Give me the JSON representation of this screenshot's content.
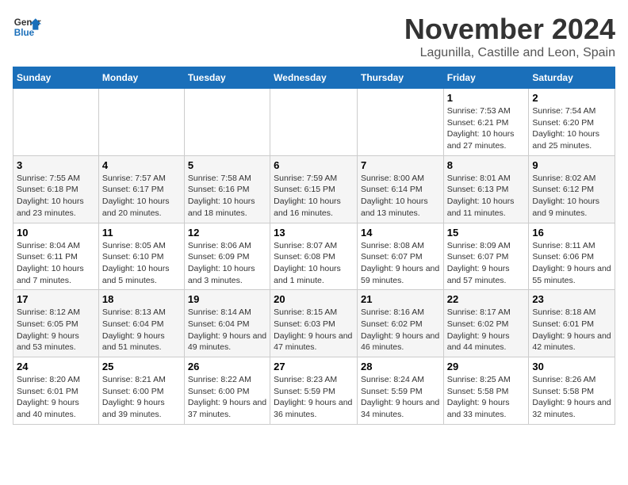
{
  "logo": {
    "line1": "General",
    "line2": "Blue"
  },
  "title": "November 2024",
  "location": "Lagunilla, Castille and Leon, Spain",
  "headers": [
    "Sunday",
    "Monday",
    "Tuesday",
    "Wednesday",
    "Thursday",
    "Friday",
    "Saturday"
  ],
  "weeks": [
    [
      {
        "day": "",
        "info": ""
      },
      {
        "day": "",
        "info": ""
      },
      {
        "day": "",
        "info": ""
      },
      {
        "day": "",
        "info": ""
      },
      {
        "day": "",
        "info": ""
      },
      {
        "day": "1",
        "info": "Sunrise: 7:53 AM\nSunset: 6:21 PM\nDaylight: 10 hours and 27 minutes."
      },
      {
        "day": "2",
        "info": "Sunrise: 7:54 AM\nSunset: 6:20 PM\nDaylight: 10 hours and 25 minutes."
      }
    ],
    [
      {
        "day": "3",
        "info": "Sunrise: 7:55 AM\nSunset: 6:18 PM\nDaylight: 10 hours and 23 minutes."
      },
      {
        "day": "4",
        "info": "Sunrise: 7:57 AM\nSunset: 6:17 PM\nDaylight: 10 hours and 20 minutes."
      },
      {
        "day": "5",
        "info": "Sunrise: 7:58 AM\nSunset: 6:16 PM\nDaylight: 10 hours and 18 minutes."
      },
      {
        "day": "6",
        "info": "Sunrise: 7:59 AM\nSunset: 6:15 PM\nDaylight: 10 hours and 16 minutes."
      },
      {
        "day": "7",
        "info": "Sunrise: 8:00 AM\nSunset: 6:14 PM\nDaylight: 10 hours and 13 minutes."
      },
      {
        "day": "8",
        "info": "Sunrise: 8:01 AM\nSunset: 6:13 PM\nDaylight: 10 hours and 11 minutes."
      },
      {
        "day": "9",
        "info": "Sunrise: 8:02 AM\nSunset: 6:12 PM\nDaylight: 10 hours and 9 minutes."
      }
    ],
    [
      {
        "day": "10",
        "info": "Sunrise: 8:04 AM\nSunset: 6:11 PM\nDaylight: 10 hours and 7 minutes."
      },
      {
        "day": "11",
        "info": "Sunrise: 8:05 AM\nSunset: 6:10 PM\nDaylight: 10 hours and 5 minutes."
      },
      {
        "day": "12",
        "info": "Sunrise: 8:06 AM\nSunset: 6:09 PM\nDaylight: 10 hours and 3 minutes."
      },
      {
        "day": "13",
        "info": "Sunrise: 8:07 AM\nSunset: 6:08 PM\nDaylight: 10 hours and 1 minute."
      },
      {
        "day": "14",
        "info": "Sunrise: 8:08 AM\nSunset: 6:07 PM\nDaylight: 9 hours and 59 minutes."
      },
      {
        "day": "15",
        "info": "Sunrise: 8:09 AM\nSunset: 6:07 PM\nDaylight: 9 hours and 57 minutes."
      },
      {
        "day": "16",
        "info": "Sunrise: 8:11 AM\nSunset: 6:06 PM\nDaylight: 9 hours and 55 minutes."
      }
    ],
    [
      {
        "day": "17",
        "info": "Sunrise: 8:12 AM\nSunset: 6:05 PM\nDaylight: 9 hours and 53 minutes."
      },
      {
        "day": "18",
        "info": "Sunrise: 8:13 AM\nSunset: 6:04 PM\nDaylight: 9 hours and 51 minutes."
      },
      {
        "day": "19",
        "info": "Sunrise: 8:14 AM\nSunset: 6:04 PM\nDaylight: 9 hours and 49 minutes."
      },
      {
        "day": "20",
        "info": "Sunrise: 8:15 AM\nSunset: 6:03 PM\nDaylight: 9 hours and 47 minutes."
      },
      {
        "day": "21",
        "info": "Sunrise: 8:16 AM\nSunset: 6:02 PM\nDaylight: 9 hours and 46 minutes."
      },
      {
        "day": "22",
        "info": "Sunrise: 8:17 AM\nSunset: 6:02 PM\nDaylight: 9 hours and 44 minutes."
      },
      {
        "day": "23",
        "info": "Sunrise: 8:18 AM\nSunset: 6:01 PM\nDaylight: 9 hours and 42 minutes."
      }
    ],
    [
      {
        "day": "24",
        "info": "Sunrise: 8:20 AM\nSunset: 6:01 PM\nDaylight: 9 hours and 40 minutes."
      },
      {
        "day": "25",
        "info": "Sunrise: 8:21 AM\nSunset: 6:00 PM\nDaylight: 9 hours and 39 minutes."
      },
      {
        "day": "26",
        "info": "Sunrise: 8:22 AM\nSunset: 6:00 PM\nDaylight: 9 hours and 37 minutes."
      },
      {
        "day": "27",
        "info": "Sunrise: 8:23 AM\nSunset: 5:59 PM\nDaylight: 9 hours and 36 minutes."
      },
      {
        "day": "28",
        "info": "Sunrise: 8:24 AM\nSunset: 5:59 PM\nDaylight: 9 hours and 34 minutes."
      },
      {
        "day": "29",
        "info": "Sunrise: 8:25 AM\nSunset: 5:58 PM\nDaylight: 9 hours and 33 minutes."
      },
      {
        "day": "30",
        "info": "Sunrise: 8:26 AM\nSunset: 5:58 PM\nDaylight: 9 hours and 32 minutes."
      }
    ]
  ]
}
